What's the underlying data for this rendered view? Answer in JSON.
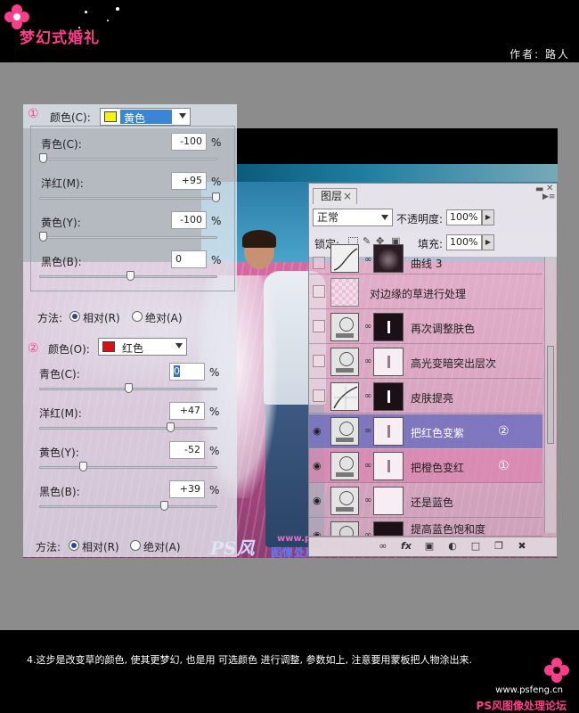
{
  "header": {
    "brand_title": "梦幻式婚礼",
    "author": "作者: 路人"
  },
  "selective_color_1": {
    "step_marker": "①",
    "colors_label": "颜色(C):",
    "selected_color": "黄色",
    "swatch_color": "#f5f21a",
    "sliders": [
      {
        "label": "青色(C):",
        "value": "-100",
        "pct": "%"
      },
      {
        "label": "洋红(M):",
        "value": "+95",
        "pct": "%"
      },
      {
        "label": "黄色(Y):",
        "value": "-100",
        "pct": "%"
      },
      {
        "label": "黑色(B):",
        "value": "0",
        "pct": "%"
      }
    ],
    "method_label": "方法:",
    "relative_label": "相对(R)",
    "absolute_label": "绝对(A)"
  },
  "selective_color_2": {
    "step_marker": "②",
    "colors_label": "颜色(O):",
    "selected_color": "红色",
    "swatch_color": "#d8101a",
    "sliders": [
      {
        "label": "青色(C):",
        "value": "0",
        "pct": "%"
      },
      {
        "label": "洋红(M):",
        "value": "+47",
        "pct": "%"
      },
      {
        "label": "黄色(Y):",
        "value": "-52",
        "pct": "%"
      },
      {
        "label": "黑色(B):",
        "value": "+39",
        "pct": "%"
      }
    ],
    "method_label": "方法:",
    "relative_label": "相对(R)",
    "absolute_label": "绝对(A)"
  },
  "layers_panel": {
    "tab_label": "图层",
    "close": "×",
    "blend_mode": "正常",
    "opacity_label": "不透明度:",
    "opacity_value": "100%",
    "lock_label": "锁定:",
    "fill_label": "填充:",
    "fill_value": "100%",
    "layers": [
      {
        "name": "曲线 3",
        "visible": false
      },
      {
        "name": "对边缘的草进行处理",
        "visible": false
      },
      {
        "name": "再次调整肤色",
        "visible": false
      },
      {
        "name": "高光变暗突出层次",
        "visible": false
      },
      {
        "name": "皮肤提亮",
        "visible": false
      },
      {
        "name": "把红色变紫",
        "visible": true,
        "badge": "②"
      },
      {
        "name": "把橙色变红",
        "visible": true,
        "badge": "①"
      },
      {
        "name": "还是蓝色",
        "visible": true
      },
      {
        "name": "提高蓝色饱和度",
        "visible": true
      }
    ],
    "bottom_icons": [
      "link-icon",
      "fx-icon",
      "mask-icon",
      "adjustment-icon",
      "group-icon",
      "new-layer-icon",
      "trash-icon"
    ]
  },
  "watermark": {
    "logo": "PS风",
    "url": "www.psfeng.cn",
    "subtitle": "图像处理论坛"
  },
  "footer": {
    "instruction": "4.这步是改变草的颜色, 使其更梦幻, 也是用 可选颜色 进行调整, 参数如上, 注意要用蒙板把人物涂出来.",
    "site_url": "www.psfeng.cn",
    "site_name": "PS风图像处理论坛"
  },
  "colors": {
    "accent_pink": "#ff3d8a",
    "selected_layer": "#6e6ebe"
  }
}
